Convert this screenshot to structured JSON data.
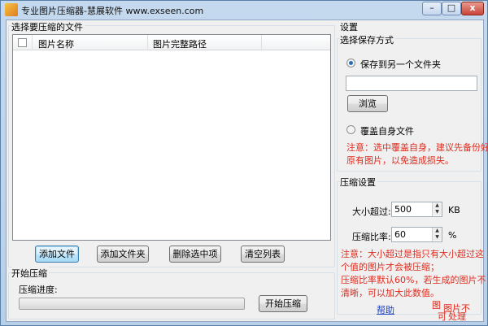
{
  "window": {
    "title": "专业图片压缩器-慧展软件 www.exseen.com",
    "min_glyph": "–",
    "max_glyph": "□",
    "close_glyph": "x"
  },
  "file_panel": {
    "group_label": "选择要压缩的文件",
    "columns": [
      "图片名称",
      "图片完整路径"
    ],
    "buttons": {
      "add_file": "添加文件",
      "add_folder": "添加文件夹",
      "delete_selected": "删除选中项",
      "clear_list": "清空列表"
    }
  },
  "compress_panel": {
    "group_label": "开始压缩",
    "progress_label": "压缩进度:",
    "progress": 0,
    "start_button": "开始压缩"
  },
  "settings": {
    "title": "设置",
    "save_mode_label": "选择保存方式",
    "save_to_other_folder": "保存到另一个文件夹",
    "save_to_other_folder_selected": true,
    "folder_path": "",
    "browse_button": "浏览",
    "overwrite_label": "覆盖自身文件",
    "overwrite_selected": false,
    "warning": [
      "注意：选中覆盖自身，建议先备份好",
      "原有图片，以免造成损失。"
    ]
  },
  "compression_settings": {
    "group_label": "压缩设置",
    "size_label": "大小超过:",
    "size_value": "500",
    "size_unit": "KB",
    "ratio_label": "压缩比率:",
    "ratio_value": "60",
    "ratio_unit": "%",
    "note": [
      "注意：大小超过是指只有大小超过这",
      "个值的图片才会被压缩；",
      "压缩比率默认60%，若生成的图片不",
      "清晰，可以加大此数值。"
    ]
  },
  "footer": {
    "help_link": "帮助",
    "partial_text_1": "图",
    "partial_text_2": "图片不",
    "partial_text_3": "可",
    "partial_text_4": "处理"
  },
  "colors": {
    "accent_red": "#e12b1e",
    "link_blue": "#1a3fbf"
  }
}
